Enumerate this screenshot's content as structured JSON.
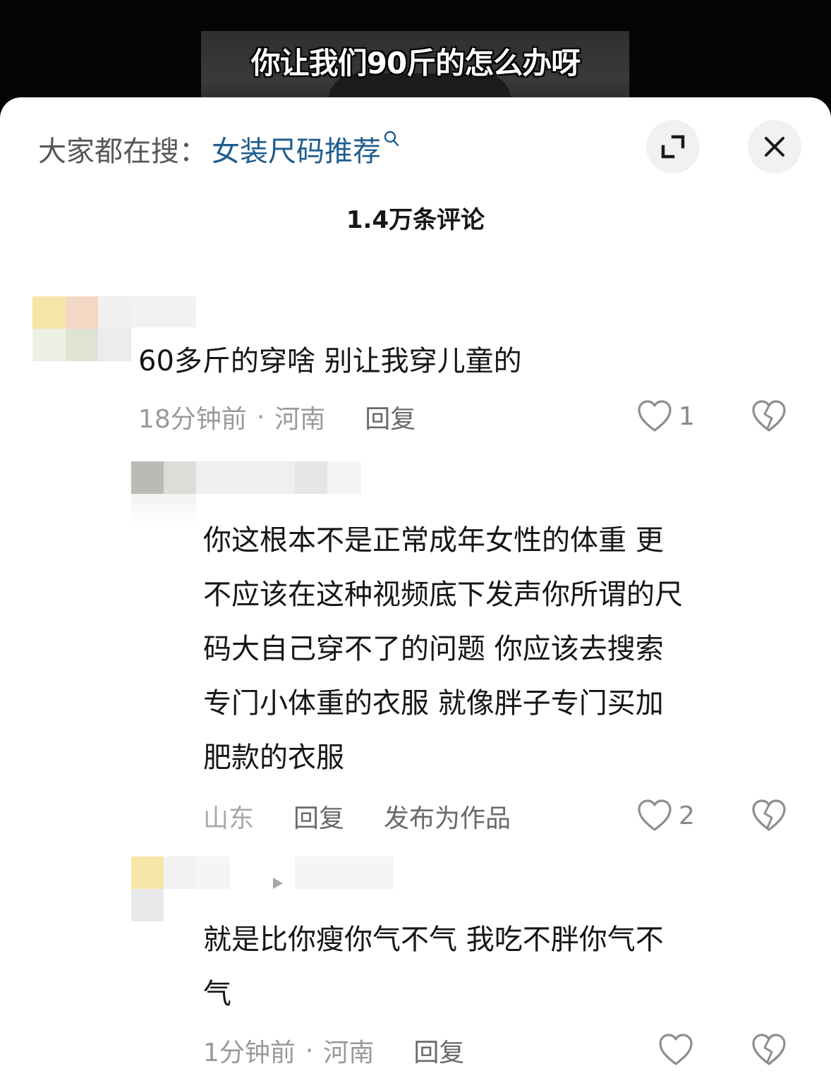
{
  "video": {
    "caption": "你让我们90斤的怎么办呀"
  },
  "search": {
    "label": "大家都在搜：",
    "term": "女装尺码推荐",
    "search_icon": "search-icon"
  },
  "header": {
    "comment_count": "1.4万条评论",
    "expand_icon": "expand-icon",
    "close_icon": "close-icon"
  },
  "comments": [
    {
      "text": "60多斤的穿啥 别让我穿儿童的",
      "time": "18分钟前",
      "sep": "·",
      "location": "河南",
      "reply_label": "回复",
      "like_count": "1",
      "colors": {
        "avatar": [
          "#f5e6a8",
          "#f3d8c4",
          "#f0f0ef",
          "#eef0e6",
          "#dfe3d3",
          "#ececec"
        ]
      }
    },
    {
      "text_lines": [
        "你这根本不是正常成年女性的体重 更",
        "不应该在这种视频底下发声你所谓的尺",
        "码大自己穿不了的问题 你应该去搜索",
        "专门小体重的衣服 就像胖子专门买加",
        "肥款的衣服"
      ],
      "location": "山东",
      "reply_label": "回复",
      "publish_label": "发布为作品",
      "like_count": "2",
      "colors": {
        "avatar": [
          "#b9bbb4",
          "#dcdcd8",
          "#efefef",
          "#f3f3f3"
        ]
      }
    },
    {
      "text_lines": [
        "就是比你瘦你气不气 我吃不胖你气不",
        "气"
      ],
      "time": "1分钟前",
      "sep": "·",
      "location": "河南",
      "reply_label": "回复",
      "like_count": "",
      "colors": {
        "avatar": [
          "#f6e7a9",
          "#f2f2f2",
          "#e8e8e8",
          "#f5f5f5"
        ]
      }
    }
  ]
}
